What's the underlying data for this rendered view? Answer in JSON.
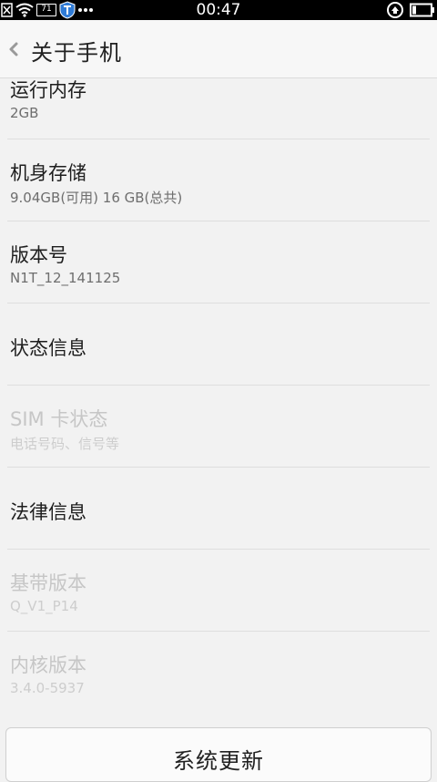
{
  "status_bar": {
    "time": "00:47",
    "sim_badge": "71",
    "icons": [
      "sim-off-icon",
      "wifi-icon",
      "sim-badge-icon",
      "shield-icon",
      "more-dots-icon",
      "sync-icon",
      "battery-icon"
    ]
  },
  "header": {
    "back_icon": "chevron-left-icon",
    "title": "关于手机"
  },
  "items": [
    {
      "title": "运行内存",
      "subtitle": "2GB",
      "enabled": true
    },
    {
      "title": "机身存储",
      "subtitle": "9.04GB(可用)   16 GB(总共)",
      "enabled": true
    },
    {
      "title": "版本号",
      "subtitle": "N1T_12_141125",
      "enabled": true
    },
    {
      "title": "状态信息",
      "subtitle": "",
      "enabled": true
    },
    {
      "title": "SIM 卡状态",
      "subtitle": "电话号码、信号等",
      "enabled": false
    },
    {
      "title": "法律信息",
      "subtitle": "",
      "enabled": true
    },
    {
      "title": "基带版本",
      "subtitle": "Q_V1_P14",
      "enabled": false
    },
    {
      "title": "内核版本",
      "subtitle": "3.4.0-5937",
      "enabled": false
    }
  ],
  "update_button": {
    "label": "系统更新"
  },
  "colors": {
    "status_bar": "#000000",
    "background": "#f2f2f2",
    "text": "#1e1e1e",
    "disabled_text": "#c6c6c6"
  }
}
